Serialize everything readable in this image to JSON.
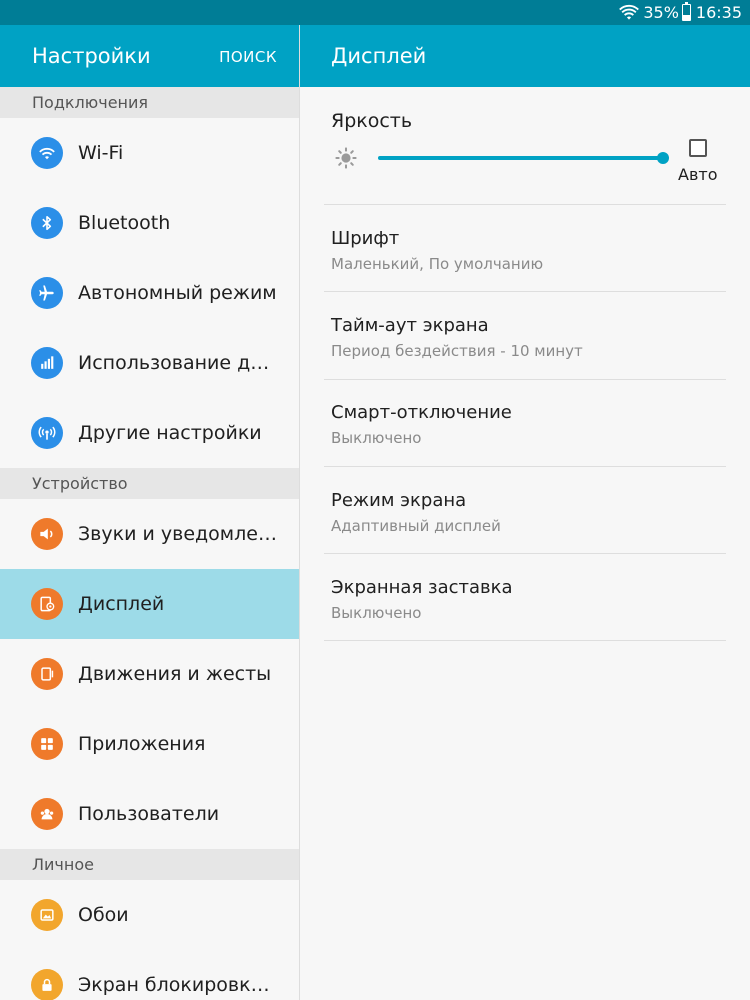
{
  "status_bar": {
    "battery_text": "35%",
    "time": "16:35"
  },
  "left_header": {
    "title": "Настройки",
    "search_label": "ПОИСК"
  },
  "right_header": {
    "title": "Дисплей"
  },
  "sidebar": {
    "sections": [
      {
        "title": "Подключения"
      },
      {
        "title": "Устройство"
      },
      {
        "title": "Личное"
      }
    ],
    "items": [
      {
        "label": "Wi-Fi",
        "icon": "wifi-icon",
        "color": "#2b8fe8"
      },
      {
        "label": "Bluetooth",
        "icon": "bluetooth-icon",
        "color": "#2b8fe8"
      },
      {
        "label": "Автономный режим",
        "icon": "airplane-icon",
        "color": "#2b8fe8"
      },
      {
        "label": "Использование данных",
        "icon": "data-usage-icon",
        "color": "#2b8fe8"
      },
      {
        "label": "Другие настройки",
        "icon": "hotspot-icon",
        "color": "#2b8fe8"
      },
      {
        "label": "Звуки и уведомления",
        "icon": "sound-icon",
        "color": "#ef7a2b"
      },
      {
        "label": "Дисплей",
        "icon": "display-icon",
        "color": "#ef7a2b"
      },
      {
        "label": "Движения и жесты",
        "icon": "motion-icon",
        "color": "#ef7a2b"
      },
      {
        "label": "Приложения",
        "icon": "apps-icon",
        "color": "#ef7a2b"
      },
      {
        "label": "Пользователи",
        "icon": "users-icon",
        "color": "#ef7a2b"
      },
      {
        "label": "Обои",
        "icon": "wallpaper-icon",
        "color": "#f2a62d"
      },
      {
        "label": "Экран блокировки и защита",
        "icon": "lock-icon",
        "color": "#f2a62d"
      }
    ]
  },
  "display": {
    "brightness": {
      "title": "Яркость",
      "auto_label": "Авто",
      "level": 1.0,
      "auto_checked": false
    },
    "rows": [
      {
        "title": "Шрифт",
        "subtitle": "Маленький, По умолчанию"
      },
      {
        "title": "Тайм-аут экрана",
        "subtitle": "Период бездействия - 10 минут"
      },
      {
        "title": "Смарт-отключение",
        "subtitle": "Выключено"
      },
      {
        "title": "Режим экрана",
        "subtitle": "Адаптивный дисплей"
      },
      {
        "title": "Экранная заставка",
        "subtitle": "Выключено"
      }
    ]
  },
  "colors": {
    "accent": "#00a2c4",
    "status_bar": "#007d96",
    "selected": "#9ddbe8"
  }
}
